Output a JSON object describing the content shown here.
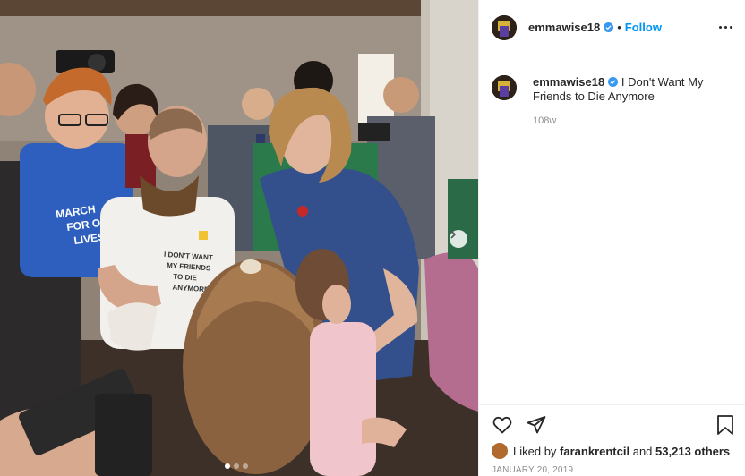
{
  "post": {
    "username": "emmawise18",
    "follow_label": "Follow",
    "separator": "•",
    "caption": "I Don't Want My Friends to Die Anymore",
    "age": "108w",
    "liked_by_prefix": "Liked by",
    "liked_by_user": "farankrentcil",
    "liked_by_and": "and",
    "likes_count": "53,213 others",
    "date": "JANUARY 20, 2019",
    "carousel": {
      "total": 3,
      "active": 1
    }
  },
  "photo": {
    "sign_text": "MARCH FOR OUR LIVES",
    "shirt_text": "I DON'T WANT MY FRIENDS TO DIE ANYMORE"
  },
  "colors": {
    "link": "#0095f6",
    "verified": "#3897f0",
    "muted": "#8e8e8e"
  },
  "icons": [
    "verified-icon",
    "more-options-icon",
    "heart-icon",
    "share-icon",
    "bookmark-icon",
    "chevron-right-icon"
  ]
}
